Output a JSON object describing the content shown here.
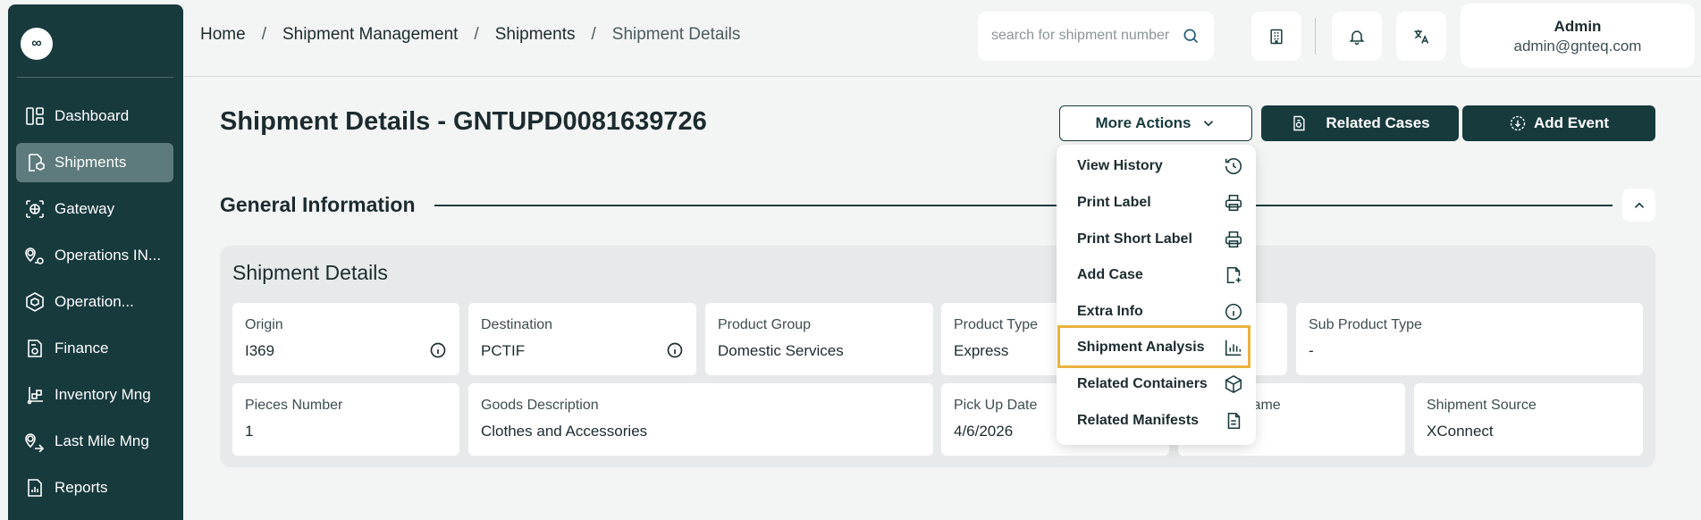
{
  "sidebar": {
    "logo": "∞",
    "items": [
      {
        "label": "Dashboard",
        "icon": "dashboard-icon",
        "active": false
      },
      {
        "label": "Shipments",
        "icon": "shipments-icon",
        "active": true
      },
      {
        "label": "Gateway",
        "icon": "gateway-icon",
        "active": false
      },
      {
        "label": "Operations IN...",
        "icon": "operations-in-icon",
        "active": false
      },
      {
        "label": "Operation...",
        "icon": "operation-icon",
        "active": false
      },
      {
        "label": "Finance",
        "icon": "finance-icon",
        "active": false
      },
      {
        "label": "Inventory Mng",
        "icon": "inventory-icon",
        "active": false
      },
      {
        "label": "Last Mile Mng",
        "icon": "last-mile-icon",
        "active": false
      },
      {
        "label": "Reports",
        "icon": "reports-icon",
        "active": false
      }
    ]
  },
  "breadcrumb": [
    "Home",
    "Shipment Management",
    "Shipments",
    "Shipment Details"
  ],
  "search": {
    "placeholder": "search for shipment number"
  },
  "user": {
    "name": "Admin",
    "email": "admin@gnteq.com"
  },
  "header": {
    "title": "Shipment Details - GNTUPD0081639726",
    "more_actions": "More Actions",
    "related_cases": "Related Cases",
    "add_event": "Add Event"
  },
  "section": {
    "title": "General Information"
  },
  "details": {
    "title": "Shipment Details",
    "fields": {
      "origin": {
        "label": "Origin",
        "value": "I369"
      },
      "destination": {
        "label": "Destination",
        "value": "PCTIF"
      },
      "product_group": {
        "label": "Product Group",
        "value": "Domestic Services"
      },
      "product_type": {
        "label": "Product Type",
        "value": "Express"
      },
      "sub_product_type": {
        "label": "Sub Product Type",
        "value": "-"
      },
      "pieces_number": {
        "label": "Pieces Number",
        "value": "1"
      },
      "goods_description": {
        "label": "Goods Description",
        "value": "Clothes and Accessories"
      },
      "pickup_date": {
        "label": "Pick Up Date",
        "value": "4/6/2026"
      },
      "name_partial": {
        "label": "lame",
        "value": ""
      },
      "shipment_source": {
        "label": "Shipment Source",
        "value": "XConnect"
      }
    }
  },
  "menu": {
    "items": [
      {
        "label": "View History",
        "icon": "history-icon"
      },
      {
        "label": "Print Label",
        "icon": "printer-icon"
      },
      {
        "label": "Print Short Label",
        "icon": "printer-icon"
      },
      {
        "label": "Add Case",
        "icon": "add-file-icon"
      },
      {
        "label": "Extra Info",
        "icon": "info-icon"
      },
      {
        "label": "Shipment Analysis",
        "icon": "bar-chart-icon",
        "highlighted": true
      },
      {
        "label": "Related Containers",
        "icon": "box-icon"
      },
      {
        "label": "Related Manifests",
        "icon": "document-icon"
      }
    ]
  },
  "colors": {
    "primary": "#173a3d",
    "highlight": "#eab23d",
    "background": "#f3f4f4"
  }
}
